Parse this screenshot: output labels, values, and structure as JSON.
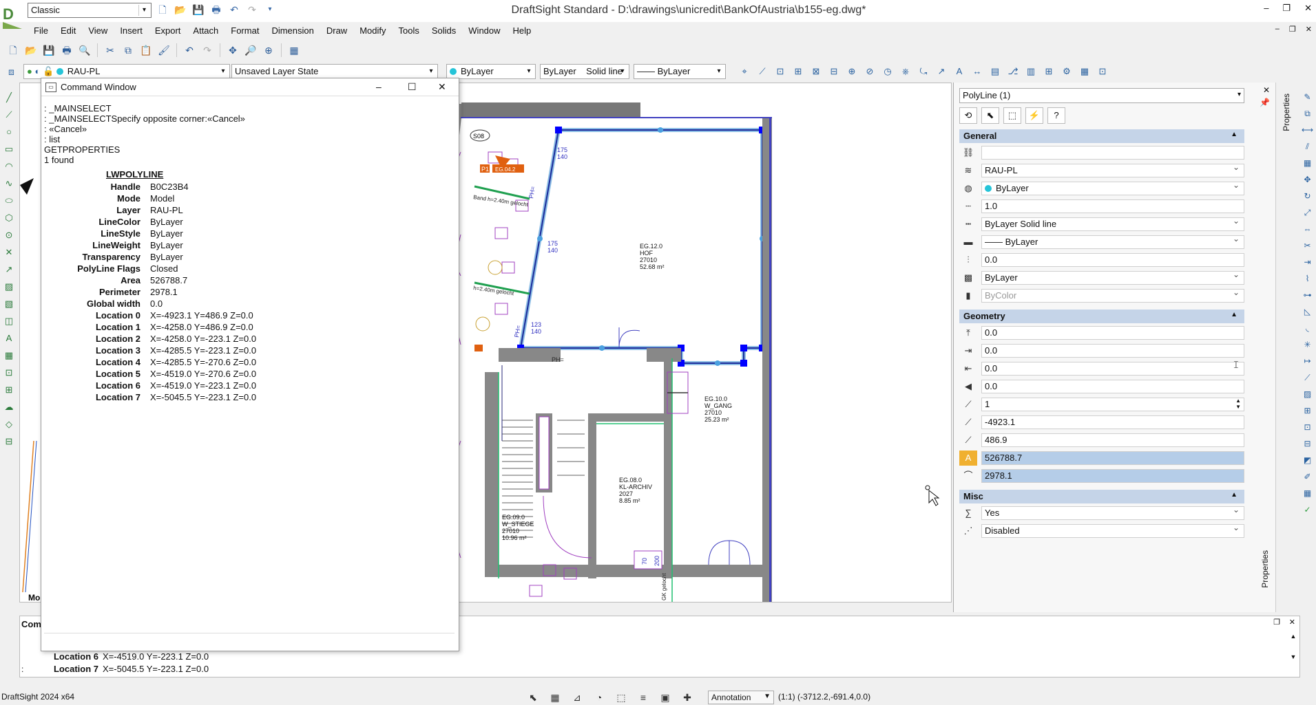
{
  "app": {
    "workspace": "Classic",
    "title": "DraftSight Standard - D:\\drawings\\unicredit\\BankOfAustria\\b155-eg.dwg*"
  },
  "menu": [
    "File",
    "Edit",
    "View",
    "Insert",
    "Export",
    "Attach",
    "Format",
    "Dimension",
    "Draw",
    "Modify",
    "Tools",
    "Solids",
    "Window",
    "Help"
  ],
  "toolbar2": {
    "layer": "RAU-PL",
    "layer_state": "Unsaved Layer State",
    "color": "ByLayer",
    "linestyle_a": "ByLayer",
    "linestyle_b": "Solid line",
    "lineweight": "—— ByLayer"
  },
  "command_window": {
    "title": "Command Window",
    "log": [
      ": _MAINSELECT",
      ": _MAINSELECTSpecify opposite corner:«Cancel»",
      ": «Cancel»",
      ": list",
      "GETPROPERTIES",
      "1 found"
    ],
    "entity_type": "LWPOLYLINE",
    "properties": [
      {
        "key": "Handle",
        "value": "B0C23B4"
      },
      {
        "key": "Mode",
        "value": "Model"
      },
      {
        "key": "Layer",
        "value": "RAU-PL"
      },
      {
        "key": "LineColor",
        "value": "ByLayer"
      },
      {
        "key": "LineStyle",
        "value": "ByLayer"
      },
      {
        "key": "LineWeight",
        "value": "ByLayer"
      },
      {
        "key": "Transparency",
        "value": "ByLayer"
      },
      {
        "key": "PolyLine Flags",
        "value": "Closed"
      },
      {
        "key": "Area",
        "value": "526788.7"
      },
      {
        "key": "Perimeter",
        "value": "2978.1"
      },
      {
        "key": "Global width",
        "value": "0.0"
      },
      {
        "key": "Location 0",
        "value": "X=-4923.1 Y=486.9 Z=0.0"
      },
      {
        "key": "Location 1",
        "value": "X=-4258.0 Y=486.9 Z=0.0"
      },
      {
        "key": "Location 2",
        "value": "X=-4258.0 Y=-223.1 Z=0.0"
      },
      {
        "key": "Location 3",
        "value": "X=-4285.5 Y=-223.1 Z=0.0"
      },
      {
        "key": "Location 4",
        "value": "X=-4285.5 Y=-270.6 Z=0.0"
      },
      {
        "key": "Location 5",
        "value": "X=-4519.0 Y=-270.6 Z=0.0"
      },
      {
        "key": "Location 6",
        "value": "X=-4519.0 Y=-223.1 Z=0.0"
      },
      {
        "key": "Location 7",
        "value": "X=-5045.5 Y=-223.1 Z=0.0"
      }
    ]
  },
  "drawing": {
    "model_tab": "Mo",
    "rooms": [
      {
        "line1": "EG.12.0",
        "line2": "HOF",
        "line3": "27010",
        "line4": "52.68 m²"
      },
      {
        "line1": "EG.10.0",
        "line2": "W_GANG",
        "line3": "27010",
        "line4": "25.23 m²"
      },
      {
        "line1": "EG.08.0",
        "line2": "KL-ARCHIV",
        "line3": "2027",
        "line4": "8.85 m²"
      },
      {
        "line1": "EG.09.0",
        "line2": "W_STIEGE",
        "line3": "27010",
        "line4": "10.96 m²"
      }
    ],
    "labels": {
      "ph": "PH=",
      "dim1": "175",
      "dim1b": "140",
      "dim2": "175",
      "dim2b": "140",
      "dim3": "123",
      "dim4": "140",
      "s08": "S08",
      "p1": "P1",
      "eg": "EG.04.2",
      "dim5": "70",
      "dim6": "200",
      "gk": "GK gelocht",
      "wall1": "Band h=2.40m gelocht",
      "wall2": "h=2.40m gelocht"
    }
  },
  "bottom_cmd": {
    "label": "Com",
    "lines": [
      {
        "key": "Location 6",
        "value": "X=-4519.0 Y=-223.1 Z=0.0"
      },
      {
        "key": "Location 7",
        "value": "X=-5045.5 Y=-223.1 Z=0.0"
      }
    ],
    "prompt": ":"
  },
  "status": {
    "version": "DraftSight 2024 x64",
    "annotation": "Annotation",
    "scale": "(1:1)",
    "coords": "(-3712.2,-691.4,0.0)"
  },
  "properties": {
    "selection": "PolyLine (1)",
    "general_label": "General",
    "general": [
      {
        "icon": "link-icon",
        "value": "",
        "dropdown": false
      },
      {
        "icon": "layers-icon",
        "value": "RAU-PL",
        "dropdown": true
      },
      {
        "icon": "color-icon",
        "value": "ByLayer",
        "dropdown": true,
        "dot": true
      },
      {
        "icon": "scale-icon",
        "value": "1.0",
        "dropdown": false
      },
      {
        "icon": "linestyle-icon",
        "value": "ByLayer     Solid line",
        "dropdown": true
      },
      {
        "icon": "lineweight-icon",
        "value": "—— ByLayer",
        "dropdown": true
      },
      {
        "icon": "thickness-icon",
        "value": "0.0",
        "dropdown": false
      },
      {
        "icon": "transparency-icon",
        "value": "ByLayer",
        "dropdown": true
      },
      {
        "icon": "plotstyle-icon",
        "value": "ByColor",
        "dropdown": true,
        "dim": true
      }
    ],
    "geometry_label": "Geometry",
    "geometry": [
      {
        "icon": "elevation-icon",
        "value": "0.0"
      },
      {
        "icon": "start-width-icon",
        "value": "0.0"
      },
      {
        "icon": "end-width-icon",
        "value": "0.0"
      },
      {
        "icon": "global-width-icon",
        "value": "0.0"
      },
      {
        "icon": "vertex-icon",
        "value": "1",
        "spinner": true
      },
      {
        "icon": "vertex-x-icon",
        "value": "-4923.1"
      },
      {
        "icon": "vertex-y-icon",
        "value": "486.9"
      },
      {
        "icon": "area-icon",
        "value": "526788.7",
        "highlight": true
      },
      {
        "icon": "length-icon",
        "value": "2978.1",
        "highlight": true
      }
    ],
    "misc_label": "Misc",
    "misc": [
      {
        "icon": "closed-icon",
        "value": "Yes",
        "dropdown": true
      },
      {
        "icon": "linegen-icon",
        "value": "Disabled",
        "dropdown": true
      }
    ],
    "tab_label": "Properties"
  }
}
